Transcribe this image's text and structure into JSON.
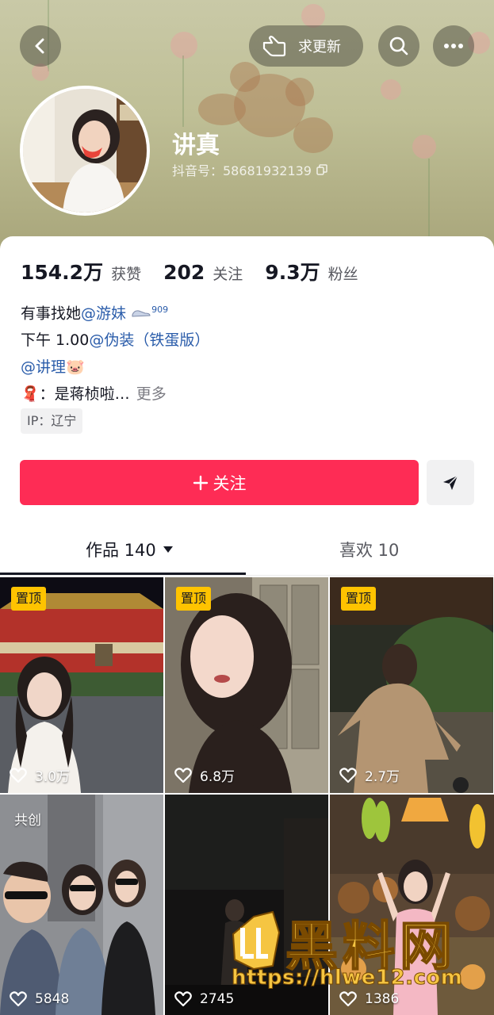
{
  "header": {
    "update_request_label": "求更新",
    "username": "讲真",
    "douyin_id": "抖音号：58681932139"
  },
  "stats": [
    {
      "value": "154.2万",
      "label": "获赞"
    },
    {
      "value": "202",
      "label": "关注"
    },
    {
      "value": "9.3万",
      "label": "粉丝"
    }
  ],
  "bio": {
    "line1_prefix": "有事找她",
    "line1_mention": "@游妹",
    "line1_badge": "909",
    "line2_prefix": "下午 1.00",
    "line2_mention": "@伪装（铁蛋版）",
    "line3_mention": "@讲理",
    "line3_emoji": "🐷",
    "line4_emoji": "🧣",
    "line4_text": "：是蒋桢啦…",
    "more_label": "更多",
    "ip": "IP：辽宁"
  },
  "actions": {
    "follow_label": "关注"
  },
  "tabs": [
    {
      "label": "作品 140"
    },
    {
      "label": "喜欢 10"
    }
  ],
  "videos": [
    {
      "tag": "置顶",
      "likes": "3.0万"
    },
    {
      "tag": "置顶",
      "likes": "6.8万"
    },
    {
      "tag": "置顶",
      "likes": "2.7万"
    },
    {
      "tag": "共创",
      "likes": "5848"
    },
    {
      "tag": "",
      "likes": "2745"
    },
    {
      "tag": "",
      "likes": "1386"
    }
  ],
  "watermark": {
    "title": "黑料网",
    "url": "https://hlwe12.com"
  },
  "colors": {
    "accent": "#fe2c55",
    "pin_badge": "#ffc300",
    "mention": "#2a5caa"
  }
}
